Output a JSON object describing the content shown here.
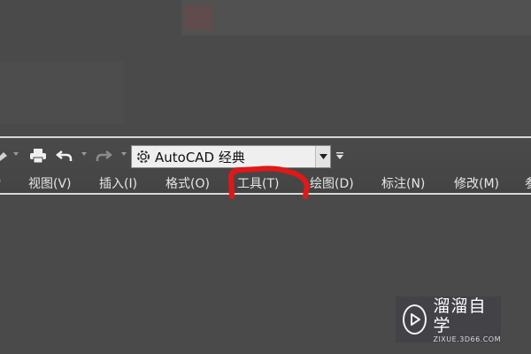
{
  "quick_access": {
    "icons": [
      "drawing-icon",
      "print-icon",
      "undo-icon",
      "redo-icon"
    ],
    "workspace_value": "AutoCAD 经典"
  },
  "menu_bar": {
    "items": [
      {
        "label": "视图(V)"
      },
      {
        "label": "插入(I)"
      },
      {
        "label": "格式(O)"
      },
      {
        "label": "工具(T)"
      },
      {
        "label": "绘图(D)"
      },
      {
        "label": "标注(N)"
      },
      {
        "label": "修改(M)"
      }
    ],
    "highlighted_item": "工具(T)"
  },
  "annotation": {
    "color": "#e01818",
    "shape": "hand-drawn underline around menu item"
  },
  "watermark": {
    "brand": "溜溜自学",
    "url": "ZIXUE.3D66.COM"
  },
  "colors": {
    "background": "#4a4a4a",
    "toolbar_border": "#d8d8d8",
    "menu_text": "#e6e6e6",
    "highlight": "#e01818"
  }
}
